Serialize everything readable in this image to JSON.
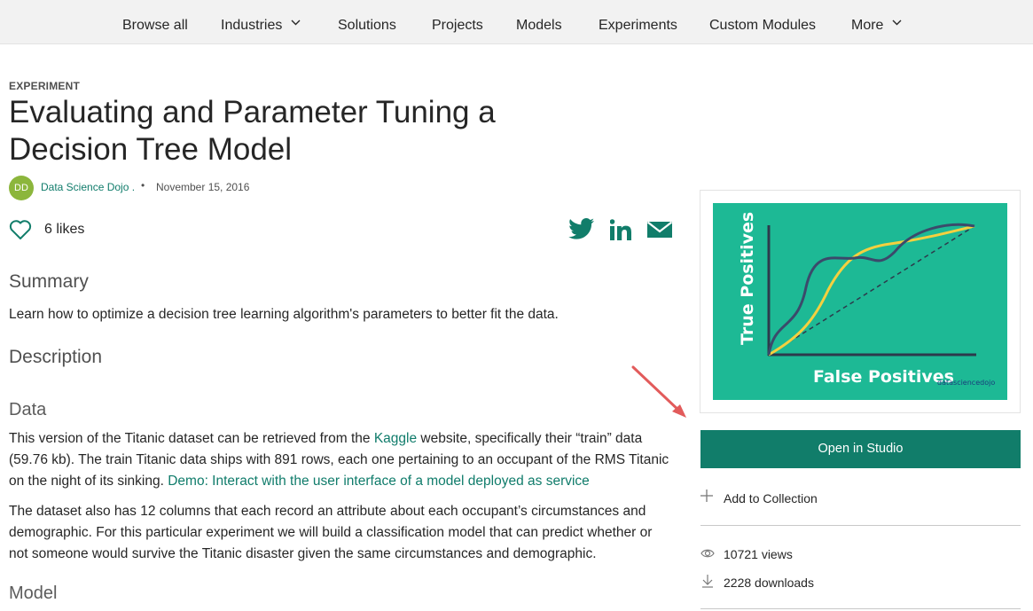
{
  "nav": {
    "items": [
      {
        "label": "Browse all"
      },
      {
        "label": "Industries",
        "has_dropdown": true
      },
      {
        "label": "Solutions"
      },
      {
        "label": "Projects"
      },
      {
        "label": "Models"
      },
      {
        "label": "Experiments"
      },
      {
        "label": "Custom Modules"
      },
      {
        "label": "More",
        "has_dropdown": true
      }
    ]
  },
  "article": {
    "eyebrow": "EXPERIMENT",
    "title": "Evaluating and Parameter Tuning a Decision Tree Model",
    "author_initials": "DD",
    "author": "Data Science Dojo .",
    "separator": "•",
    "date": "November 15, 2016",
    "likes": "6 likes"
  },
  "share": {
    "icons": [
      "twitter-icon",
      "linkedin-icon",
      "mail-icon"
    ],
    "brand_color": "#117d6a"
  },
  "content": {
    "summary_heading": "Summary",
    "summary_text": "Learn how to optimize a decision tree learning algorithm's parameters to better fit the data.",
    "description_heading": "Description",
    "data_heading": "Data",
    "data_p1_a": "This version of the Titanic dataset can be retrieved from the ",
    "data_p1_link": "Kaggle",
    "data_p1_b": " website, specifically their “train” data (59.76 kb). The train Titanic data ships with 891 rows, each one pertaining to an occupant of the RMS Titanic on the night of its sinking. ",
    "data_p1_link2": "Demo: Interact with the user interface of a model deployed as service",
    "data_p2": "The dataset also has 12 columns that each record an attribute about each occupant’s circumstances and demographic. For this particular experiment we will build a classification model that can predict whether or not someone would survive the Titanic disaster given the same circumstances and demographic.",
    "model_heading": "Model"
  },
  "thumbnail": {
    "y_label": "True Positives",
    "x_label": "False Positives",
    "logo_text": "datasciencedojo",
    "bg_color": "#1db995"
  },
  "sidebar": {
    "open_button": "Open in Studio",
    "add_collection": "Add to Collection",
    "views": "10721 views",
    "downloads": "2228 downloads"
  }
}
